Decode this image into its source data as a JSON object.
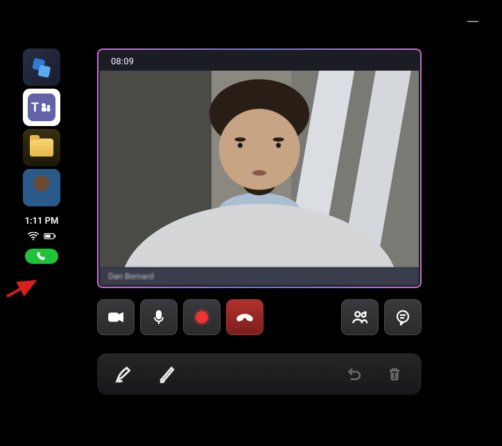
{
  "window": {
    "minimize_icon": "minimize"
  },
  "sidebar": {
    "tiles": [
      {
        "name": "shapes-app",
        "icon": "shapes-icon"
      },
      {
        "name": "teams-app",
        "icon": "teams-icon",
        "active": true
      },
      {
        "name": "files-app",
        "icon": "folder-icon"
      },
      {
        "name": "user-avatar",
        "icon": "avatar-icon"
      }
    ],
    "time": "1:11 PM",
    "wifi_icon": "wifi-icon",
    "battery_icon": "battery-icon",
    "call_indicator_icon": "phone-icon",
    "call_indicator_color": "#1ec33a"
  },
  "annotation_arrow": {
    "color": "#d8201a"
  },
  "call": {
    "timer": "08:09",
    "participant_name": "Dan Bernard",
    "controls": {
      "camera": "camera-icon",
      "mic": "mic-icon",
      "record": "record-icon",
      "hangup": "hangup-icon",
      "people": "people-icon",
      "chat": "chat-icon"
    }
  },
  "annotate_bar": {
    "pen": "pen-icon",
    "draw": "draw-icon",
    "undo": "undo-icon",
    "delete": "trash-icon"
  }
}
